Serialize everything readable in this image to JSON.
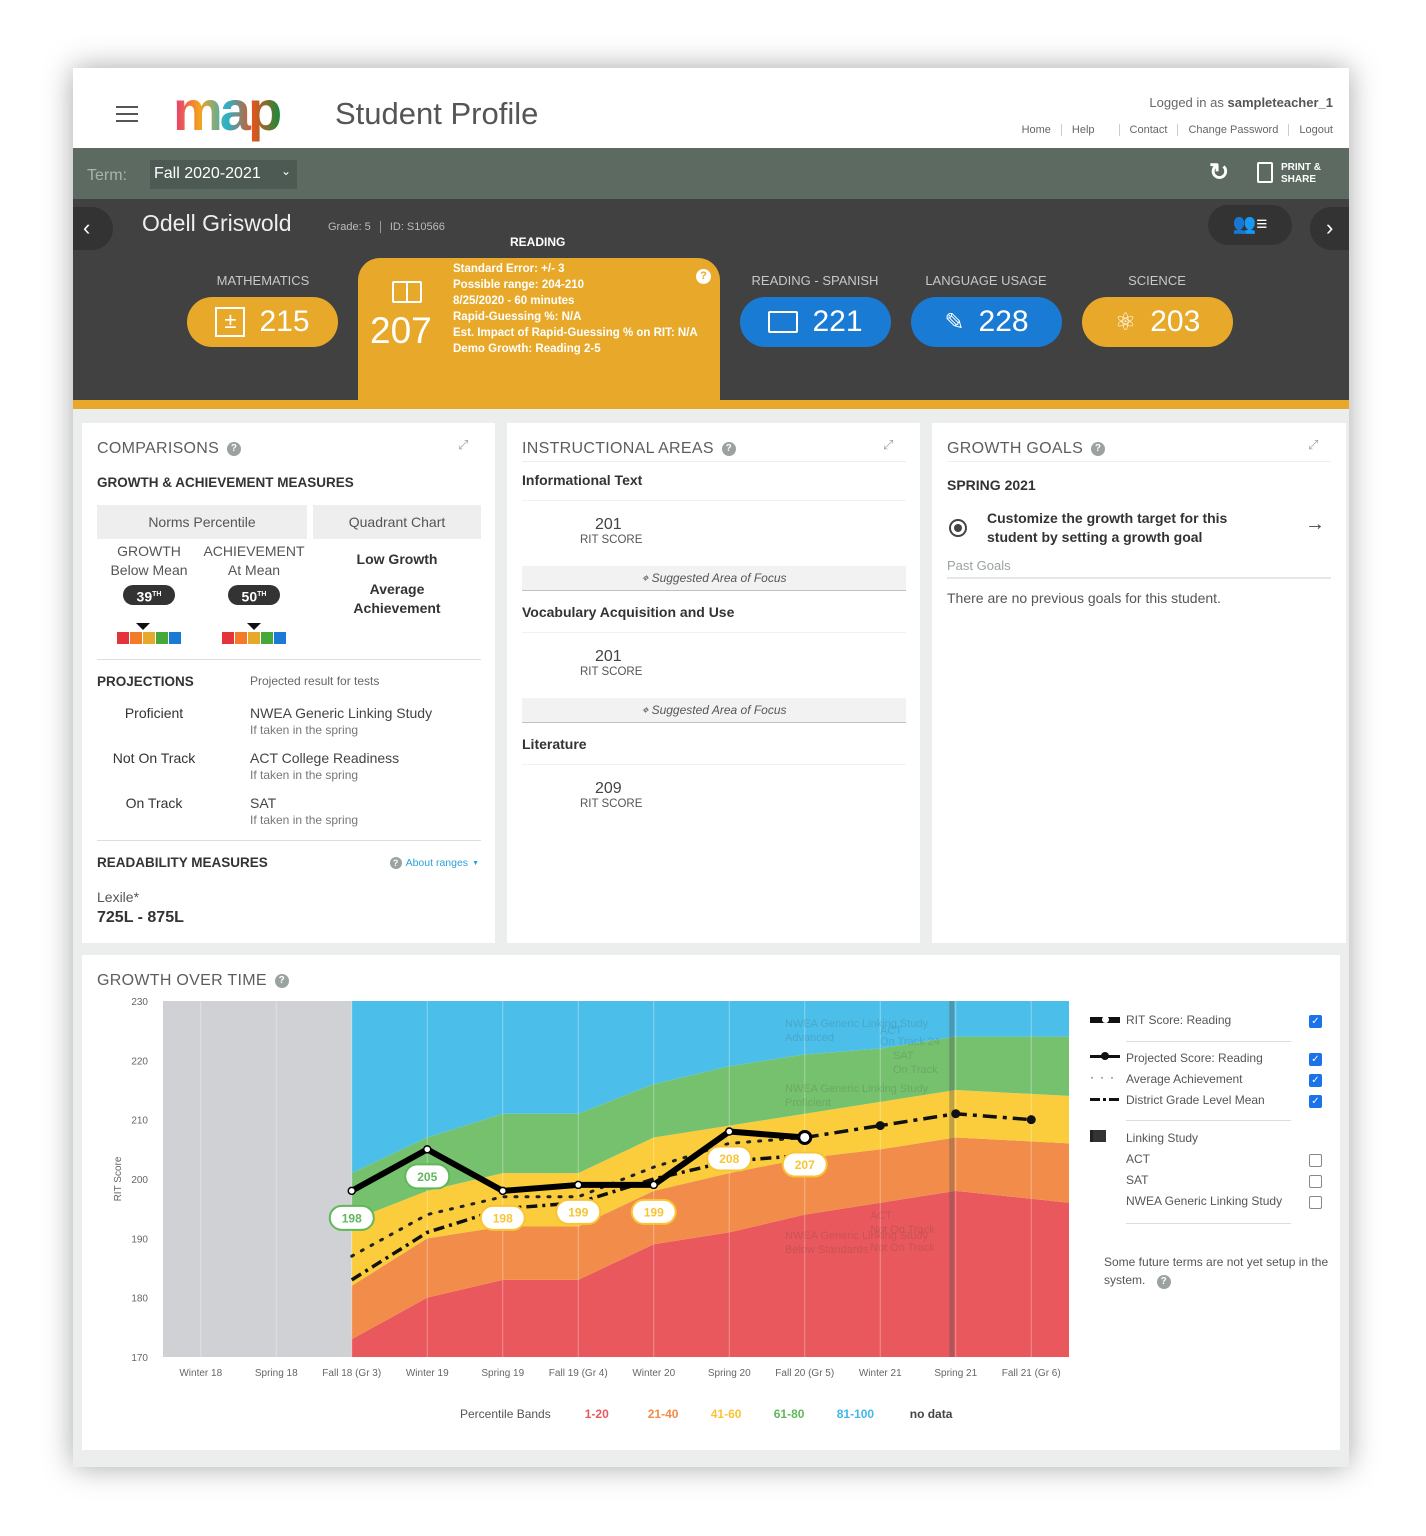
{
  "header": {
    "logo_text": "map",
    "title": "Student Profile",
    "logged_in_prefix": "Logged in as",
    "username": "sampleteacher_1",
    "links": [
      "Home",
      "Help",
      "Contact",
      "Change Password",
      "Logout"
    ]
  },
  "termbar": {
    "label": "Term:",
    "term": "Fall 2020-2021",
    "print_label_1": "PRINT &",
    "print_label_2": "SHARE"
  },
  "student": {
    "name": "Odell Griswold",
    "grade": "Grade: 5",
    "id": "ID: S10566"
  },
  "subjects": [
    {
      "label": "MATHEMATICS",
      "score": "215",
      "icon": "calculator-icon",
      "color": "#e8a92a"
    },
    {
      "label": "READING",
      "score": "207",
      "icon": "book-icon",
      "color": "#e8a92a",
      "details": [
        "Standard Error: +/- 3",
        "Possible range: 204-210",
        "8/25/2020 - 60 minutes",
        "Rapid-Guessing %: N/A",
        "Est. Impact of Rapid-Guessing % on RIT: N/A",
        "Demo Growth: Reading 2-5"
      ]
    },
    {
      "label": "READING - SPANISH",
      "score": "221",
      "icon": "book-icon",
      "color": "#1a7bd4"
    },
    {
      "label": "LANGUAGE USAGE",
      "score": "228",
      "icon": "edit-icon",
      "color": "#1a7bd4"
    },
    {
      "label": "SCIENCE",
      "score": "203",
      "icon": "atom-icon",
      "color": "#e8a92a"
    }
  ],
  "comparisons": {
    "title": "COMPARISONS",
    "subtitle": "GROWTH & ACHIEVEMENT MEASURES",
    "tabs": [
      "Norms Percentile",
      "Quadrant Chart"
    ],
    "growth": {
      "label": "GROWTH",
      "desc": "Below Mean",
      "pct": "39",
      "sup": "TH",
      "level": 0.39
    },
    "achievement": {
      "label": "ACHIEVEMENT",
      "desc": "At Mean",
      "pct": "50",
      "sup": "TH",
      "level": 0.5
    },
    "quadrant": [
      "Low Growth",
      "Average Achievement"
    ],
    "projections": {
      "title": "PROJECTIONS",
      "subtitle": "Projected result for tests",
      "rows": [
        {
          "status": "Proficient",
          "test": "NWEA Generic Linking Study",
          "note": "If taken in the spring"
        },
        {
          "status": "Not On Track",
          "test": "ACT College Readiness",
          "note": "If taken in the spring"
        },
        {
          "status": "On Track",
          "test": "SAT",
          "note": "If taken in the spring"
        }
      ]
    },
    "readability": {
      "title": "READABILITY MEASURES",
      "about": "About ranges",
      "lexile_label": "Lexile*",
      "lexile_range": "725L - 875L"
    }
  },
  "instructional": {
    "title": "INSTRUCTIONAL AREAS",
    "areas": [
      {
        "name": "Informational Text",
        "score": "201",
        "score_label": "RIT SCORE",
        "focus": "Suggested Area of Focus"
      },
      {
        "name": "Vocabulary Acquisition and Use",
        "score": "201",
        "score_label": "RIT SCORE",
        "focus": "Suggested Area of Focus"
      },
      {
        "name": "Literature",
        "score": "209",
        "score_label": "RIT SCORE"
      }
    ]
  },
  "goals": {
    "title": "GROWTH GOALS",
    "term": "SPRING 2021",
    "cta": "Customize the growth target for this student by setting a growth goal",
    "past_label": "Past Goals",
    "empty": "There are no previous goals for this student."
  },
  "growth": {
    "title": "GROWTH OVER TIME",
    "legend": {
      "rit": "RIT Score: Reading",
      "projected": "Projected Score: Reading",
      "avg": "Average Achievement",
      "district": "District Grade Level Mean",
      "linking": "Linking Study",
      "act": "ACT",
      "sat": "SAT",
      "nwea": "NWEA Generic Linking Study",
      "checks": {
        "rit": true,
        "projected": true,
        "avg": true,
        "district": true,
        "act": false,
        "sat": false,
        "nwea": false
      },
      "note": "Some future terms are not yet setup in the system."
    },
    "bands_legend": {
      "title": "Percentile Bands",
      "items": [
        {
          "label": "1-20",
          "color": "#e8585c"
        },
        {
          "label": "21-40",
          "color": "#f28c4a"
        },
        {
          "label": "41-60",
          "color": "#f9c433"
        },
        {
          "label": "61-80",
          "color": "#5fb85a"
        },
        {
          "label": "81-100",
          "color": "#41b8e6"
        },
        {
          "label": "no data",
          "color": "#444444"
        }
      ]
    }
  },
  "chart_data": {
    "type": "line",
    "ylabel": "RIT Score",
    "ylim": [
      170,
      230
    ],
    "yticks": [
      230,
      220,
      210,
      200,
      190,
      180,
      170
    ],
    "categories": [
      "Winter 18",
      "Spring 18",
      "Fall 18 (Gr 3)",
      "Winter 19",
      "Spring 19",
      "Fall 19 (Gr 4)",
      "Winter 20",
      "Spring 20",
      "Fall 20 (Gr 5)",
      "Winter 21",
      "Spring 21",
      "Fall 21 (Gr 6)"
    ],
    "band_colors": [
      "#e8585c",
      "#f28c4a",
      "#fbcd3c",
      "#76c16d",
      "#4bbfe9"
    ],
    "no_data_color": "#d0d1d4",
    "band_upper_bounds": {
      "p20": [
        null,
        null,
        173,
        180,
        183,
        183,
        189,
        191,
        194,
        196,
        198,
        196
      ],
      "p40": [
        null,
        null,
        182,
        190,
        192,
        192,
        198,
        201,
        203.5,
        205,
        207,
        206
      ],
      "p60": [
        null,
        null,
        193,
        198,
        201,
        201,
        207,
        209,
        211,
        213,
        215,
        214
      ],
      "p80": [
        null,
        null,
        201,
        207,
        211,
        211,
        216,
        219,
        221,
        222,
        224,
        224
      ]
    },
    "series": [
      {
        "name": "RIT Score: Reading",
        "values": [
          null,
          null,
          198,
          205,
          198,
          199,
          199,
          208,
          207,
          null,
          null,
          null
        ],
        "labels": [
          "",
          "",
          "198",
          "205",
          "198",
          "199",
          "199",
          "208",
          "207",
          "",
          "",
          ""
        ],
        "label_colors": [
          "",
          "",
          "#5fb85a",
          "#5fb85a",
          "#f9c433",
          "#f9c433",
          "#f9c433",
          "#f9c433",
          "#f9c433",
          "",
          "",
          ""
        ]
      },
      {
        "name": "Projected Score: Reading",
        "values": [
          null,
          null,
          null,
          null,
          null,
          null,
          null,
          null,
          207,
          209,
          211,
          210
        ]
      },
      {
        "name": "Average Achievement",
        "values": [
          null,
          null,
          187,
          194,
          197,
          197,
          202,
          206,
          207,
          null,
          null,
          null
        ]
      },
      {
        "name": "District Grade Level Mean",
        "values": [
          null,
          null,
          183,
          191,
          195,
          196,
          200,
          203,
          204,
          null,
          null,
          null
        ]
      }
    ],
    "annotations": [
      "NWEA Generic Linking Study",
      "Advanced",
      "ACT",
      "On Track 24",
      "SAT",
      "On Track",
      "NWEA Generic Linking Study",
      "Proficient",
      "ACT",
      "Not On Track",
      "NWEA Generic Linking Study",
      "Below Standards",
      "Not On Track"
    ],
    "grid": true
  }
}
